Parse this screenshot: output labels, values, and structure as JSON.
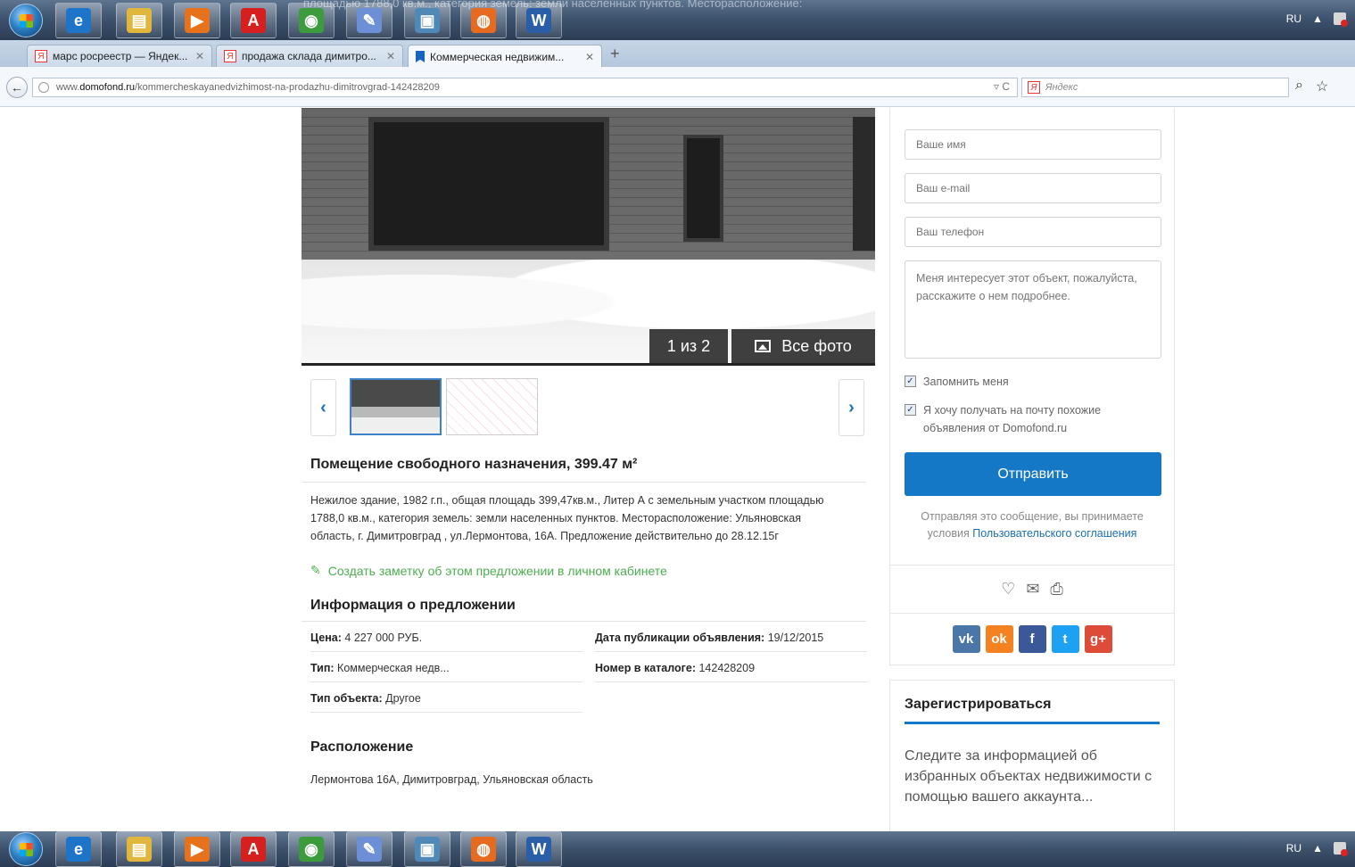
{
  "taskbar": {
    "ghost_text": "площадью 1788,0 кв.м., категория земель: земли населенных пунктов. Месторасположение:",
    "lang": "RU",
    "apps": [
      {
        "name": "ie",
        "glyph": "e",
        "color": "#1e74c9"
      },
      {
        "name": "explorer",
        "glyph": "▤",
        "color": "#e0b73c"
      },
      {
        "name": "media",
        "glyph": "▶",
        "color": "#e8721c"
      },
      {
        "name": "acrobat",
        "glyph": "A",
        "color": "#d61f1f"
      },
      {
        "name": "chrome",
        "glyph": "◉",
        "color": "#3c9b3c"
      },
      {
        "name": "paint",
        "glyph": "✎",
        "color": "#6c8fd6"
      },
      {
        "name": "photos",
        "glyph": "▣",
        "color": "#4f89b8"
      },
      {
        "name": "firefox",
        "glyph": "◍",
        "color": "#e66a1f"
      },
      {
        "name": "word",
        "glyph": "W",
        "color": "#2b5ea8"
      }
    ]
  },
  "browser": {
    "tabs": [
      {
        "label": "марс росреестр — Яндек...",
        "icon": "Я"
      },
      {
        "label": "продажа склада димитро...",
        "icon": "Я"
      },
      {
        "label": "Коммерческая недвижим...",
        "icon": "bookmark"
      }
    ],
    "new_tab": "+",
    "url_prefix": "www.",
    "url_domain": "domofond.ru",
    "url_path": "/kommercheskayanedvizhimost-na-prodazhu-dimitrovgrad-142428209",
    "search_placeholder": "Яндекс",
    "search_engine": "Я"
  },
  "gallery": {
    "counter": "1 из 2",
    "all_photos": "Все фото"
  },
  "listing": {
    "title": "Помещение свободного назначения, 399.47 м²",
    "description": "Нежилое здание, 1982 г.п., общая площадь 399,47кв.м., Литер А с земельным участком площадью 1788,0 кв.м., категория земель: земли населенных пунктов. Месторасположение: Ульяновская область, г. Димитровград , ул.Лермонтова, 16А. Предложение действительно до 28.12.15г",
    "note_link": "Создать заметку об этом предложении в личном кабинете",
    "info_heading": "Информация о предложении",
    "info": {
      "price_label": "Цена:",
      "price_value": "4 227 000 РУБ.",
      "date_label": "Дата публикации объявления:",
      "date_value": "19/12/2015",
      "type_label": "Тип:",
      "type_value": "Коммерческая недв...",
      "catalog_label": "Номер в каталоге:",
      "catalog_value": "142428209",
      "object_label": "Тип объекта:",
      "object_value": "Другое"
    },
    "location_heading": "Расположение",
    "location_text": "Лермонтова 16А, Димитровград, Ульяновская область"
  },
  "contact_form": {
    "name_placeholder": "Ваше имя",
    "email_placeholder": "Ваш e-mail",
    "phone_placeholder": "Ваш телефон",
    "message": "Меня интересует этот объект, пожалуйста, расскажите о нем подробнее.",
    "remember_me": "Запомнить меня",
    "subscribe": "Я хочу получать на почту похожие объявления от Domofond.ru",
    "submit": "Отправить",
    "agree_text": "Отправляя это сообщение, вы принимаете условия",
    "agree_link": "Пользовательского соглашения"
  },
  "social": [
    {
      "name": "vk",
      "glyph": "vk",
      "color": "#4a76a8"
    },
    {
      "name": "odnoklassniki",
      "glyph": "ok",
      "color": "#f58220"
    },
    {
      "name": "facebook",
      "glyph": "f",
      "color": "#3b5998"
    },
    {
      "name": "twitter",
      "glyph": "t",
      "color": "#1da1f2"
    },
    {
      "name": "google-plus",
      "glyph": "g+",
      "color": "#dd4b39"
    }
  ],
  "register": {
    "title": "Зарегистрироваться",
    "text": "Следите за информацией об избранных объектах недвижимости с помощью вашего аккаунта..."
  },
  "colors": {
    "accent": "#1478c6",
    "link_green": "#4caf50"
  }
}
